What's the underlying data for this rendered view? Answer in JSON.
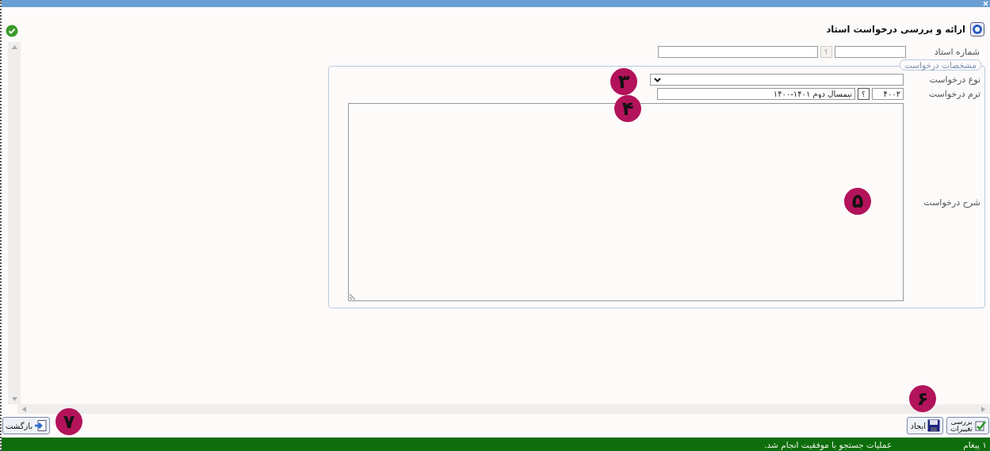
{
  "window": {
    "title": "ارائه و بررسی درخواست استاد"
  },
  "teacher_number": {
    "label": "شماره استاد",
    "lookup": "؟"
  },
  "request_details": {
    "legend": "مشخصات درخواست",
    "request_type": {
      "label": "نوع درخواست"
    },
    "request_term": {
      "label": "ترم درخواست",
      "code": "۴۰۰۲",
      "lookup": "؟",
      "name": "نیمسال دوم ۱۴۰۱-۱۴۰۰"
    },
    "description": {
      "label": "شرح درخواست"
    }
  },
  "buttons": [
    {
      "kind": "review",
      "label": "بررسی تغییرات"
    },
    {
      "kind": "create",
      "label": "ایجاد"
    }
  ],
  "back_button": {
    "label": "بازگشت"
  },
  "status_bar": {
    "count": "۱ پیغام",
    "message": "عملیات جستجو با موفقیت انجام شد."
  },
  "annotations": [
    {
      "kind": "type",
      "label": "۳"
    },
    {
      "kind": "term",
      "label": "۴"
    },
    {
      "kind": "desc",
      "label": "۵"
    },
    {
      "kind": "buttons",
      "label": "۶"
    },
    {
      "kind": "back",
      "label": "۷"
    }
  ]
}
